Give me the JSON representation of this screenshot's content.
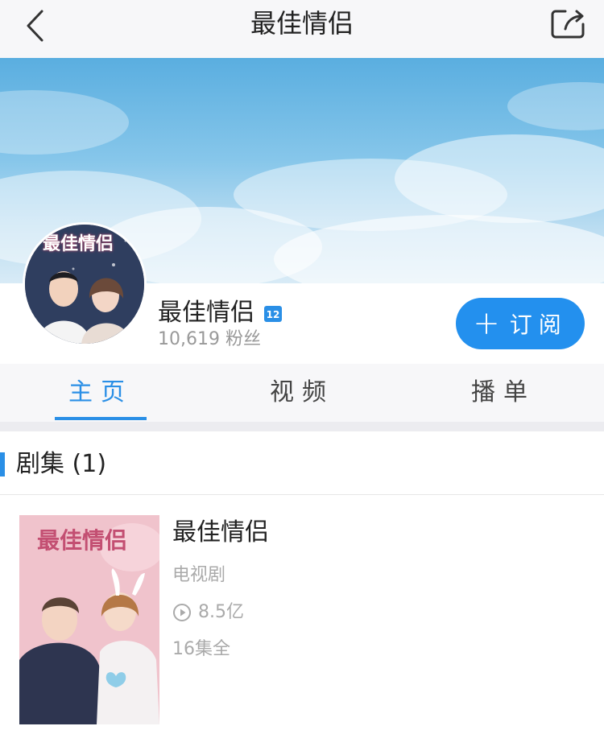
{
  "navbar": {
    "title": "最佳情侣",
    "back_icon": "chevron-left-icon",
    "share_icon": "share-icon"
  },
  "channel": {
    "name": "最佳情侣",
    "badge": "12",
    "fans": "10,619 粉丝",
    "avatar_title": "最佳情侣"
  },
  "subscribe": {
    "plus": "+",
    "label": "订阅"
  },
  "tabs": [
    {
      "label": "主页",
      "active": true
    },
    {
      "label": "视频",
      "active": false
    },
    {
      "label": "播单",
      "active": false
    }
  ],
  "section": {
    "title": "剧集 (1)"
  },
  "show": {
    "title": "最佳情侣",
    "poster_title": "最佳情侣",
    "type": "电视剧",
    "plays": "8.5亿",
    "episodes": "16集全"
  },
  "colors": {
    "accent": "#2390ee",
    "tab_active": "#2a8fe6",
    "muted": "#aaaaaa"
  }
}
